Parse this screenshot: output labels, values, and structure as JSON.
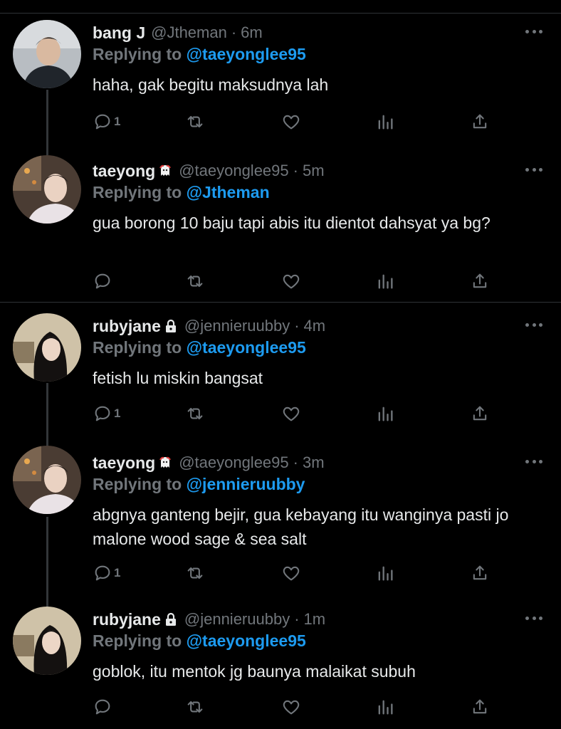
{
  "tweets": [
    {
      "name": "bang J",
      "badge": "",
      "handle": "@Jtheman",
      "time": "6m",
      "reply_prefix": "Replying to",
      "reply_to": "@taeyonglee95",
      "text": "haha, gak begitu maksudnya lah",
      "reply_count": "1",
      "avatar_colors": [
        "#c9cdd2",
        "#2a3138"
      ]
    },
    {
      "name": "taeyong",
      "badge": "ghost-emoji-icon",
      "handle": "@taeyonglee95",
      "time": "5m",
      "reply_prefix": "Replying to",
      "reply_to": "@Jtheman",
      "text": "gua borong 10 baju tapi abis itu dientot dahsyat ya bg?",
      "reply_count": "",
      "avatar_colors": [
        "#6b5a4a",
        "#e8d6cc"
      ]
    },
    {
      "name": "rubyjane",
      "badge": "lock-icon",
      "handle": "@jennieruubby",
      "time": "4m",
      "reply_prefix": "Replying to",
      "reply_to": "@taeyonglee95",
      "text": "fetish lu miskin bangsat",
      "reply_count": "1",
      "avatar_colors": [
        "#d7cbb5",
        "#1e1a18"
      ]
    },
    {
      "name": "taeyong",
      "badge": "ghost-emoji-icon",
      "handle": "@taeyonglee95",
      "time": "3m",
      "reply_prefix": "Replying to",
      "reply_to": "@jennieruubby",
      "text": "abgnya ganteng bejir, gua kebayang itu wanginya pasti jo malone wood sage & sea salt",
      "reply_count": "1",
      "avatar_colors": [
        "#6b5a4a",
        "#e8d6cc"
      ]
    },
    {
      "name": "rubyjane",
      "badge": "lock-icon",
      "handle": "@jennieruubby",
      "time": "1m",
      "reply_prefix": "Replying to",
      "reply_to": "@taeyonglee95",
      "text": "goblok, itu mentok jg baunya malaikat subuh",
      "reply_count": "",
      "avatar_colors": [
        "#d7cbb5",
        "#1e1a18"
      ]
    }
  ],
  "colors": {
    "background": "#000000",
    "text": "#e7e9ea",
    "muted": "#71767b",
    "link": "#1d9bf0",
    "separator": "#2f3336"
  },
  "icons": [
    "reply-icon",
    "retweet-icon",
    "like-icon",
    "views-icon",
    "share-icon",
    "more-icon"
  ]
}
